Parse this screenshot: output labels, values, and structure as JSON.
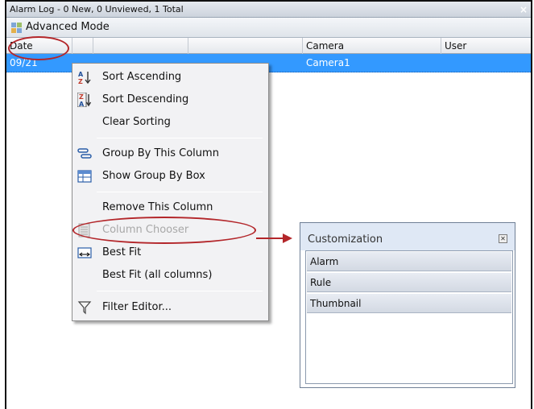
{
  "window": {
    "title": "Alarm Log - 0 New, 0 Unviewed, 1 Total",
    "close_glyph": "×"
  },
  "toolbar": {
    "advanced_mode_label": "Advanced Mode",
    "advanced_mode_icon": "advanced-mode-icon"
  },
  "grid": {
    "columns": [
      "Date",
      "",
      "",
      "",
      "Camera",
      "User"
    ],
    "rows": [
      {
        "date": "09/21",
        "camera": "Camera1"
      }
    ]
  },
  "context_menu": {
    "items": [
      {
        "label": "Sort Ascending",
        "icon": "sort-ascending-icon",
        "enabled": true
      },
      {
        "label": "Sort Descending",
        "icon": "sort-descending-icon",
        "enabled": true
      },
      {
        "label": "Clear Sorting",
        "icon": "",
        "enabled": true
      },
      {
        "label": "Group By This Column",
        "icon": "group-by-icon",
        "enabled": true
      },
      {
        "label": "Show Group By Box",
        "icon": "group-box-icon",
        "enabled": true
      },
      {
        "label": "Remove This Column",
        "icon": "",
        "enabled": true
      },
      {
        "label": "Column Chooser",
        "icon": "column-chooser-icon",
        "enabled": false
      },
      {
        "label": "Best Fit",
        "icon": "best-fit-icon",
        "enabled": true
      },
      {
        "label": "Best Fit (all columns)",
        "icon": "",
        "enabled": true
      },
      {
        "label": "Filter Editor...",
        "icon": "filter-icon",
        "enabled": true
      }
    ]
  },
  "customization": {
    "title": "Customization",
    "close_glyph": "⊠",
    "items": [
      "Alarm",
      "Rule",
      "Thumbnail"
    ]
  },
  "colors": {
    "selection": "#3399ff",
    "highlight": "#b3262a"
  }
}
